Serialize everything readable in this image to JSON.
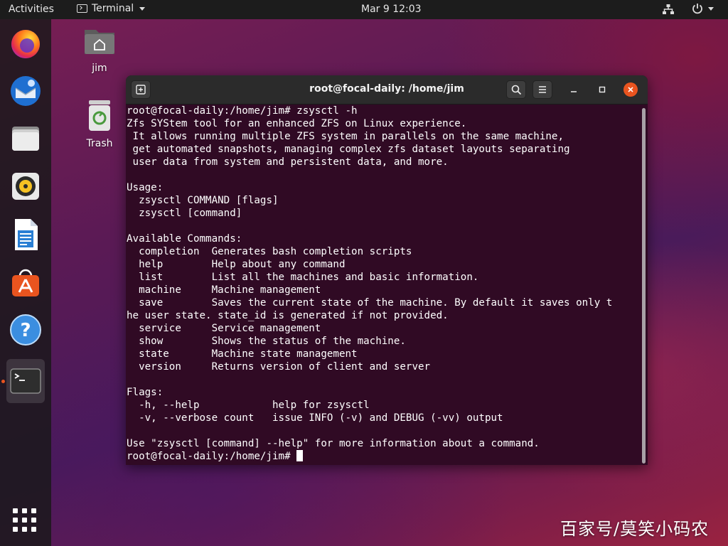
{
  "topbar": {
    "activities": "Activities",
    "app_menu": "Terminal",
    "clock": "Mar 9  12:03"
  },
  "dock": {
    "items": [
      {
        "name": "firefox-icon"
      },
      {
        "name": "thunderbird-icon"
      },
      {
        "name": "files-icon"
      },
      {
        "name": "rhythmbox-icon"
      },
      {
        "name": "libreoffice-writer-icon"
      },
      {
        "name": "ubuntu-software-icon"
      },
      {
        "name": "help-icon"
      },
      {
        "name": "terminal-icon"
      }
    ]
  },
  "desktop": {
    "home_label": "jim",
    "trash_label": "Trash"
  },
  "terminal": {
    "title": "root@focal-daily: /home/jim",
    "lines": [
      "root@focal-daily:/home/jim# zsysctl -h",
      "Zfs SYStem tool for an enhanced ZFS on Linux experience.",
      " It allows running multiple ZFS system in parallels on the same machine,",
      " get automated snapshots, managing complex zfs dataset layouts separating",
      " user data from system and persistent data, and more.",
      "",
      "Usage:",
      "  zsysctl COMMAND [flags]",
      "  zsysctl [command]",
      "",
      "Available Commands:",
      "  completion  Generates bash completion scripts",
      "  help        Help about any command",
      "  list        List all the machines and basic information.",
      "  machine     Machine management",
      "  save        Saves the current state of the machine. By default it saves only t",
      "he user state. state_id is generated if not provided.",
      "  service     Service management",
      "  show        Shows the status of the machine.",
      "  state       Machine state management",
      "  version     Returns version of client and server",
      "",
      "Flags:",
      "  -h, --help            help for zsysctl",
      "  -v, --verbose count   issue INFO (-v) and DEBUG (-vv) output",
      "",
      "Use \"zsysctl [command] --help\" for more information about a command.",
      "root@focal-daily:/home/jim# "
    ]
  },
  "watermark": "百家号/莫笑小码农",
  "colors": {
    "terminal_bg": "#300a24",
    "close_button": "#e9541f",
    "topbar_bg": "#1c1c1c"
  }
}
